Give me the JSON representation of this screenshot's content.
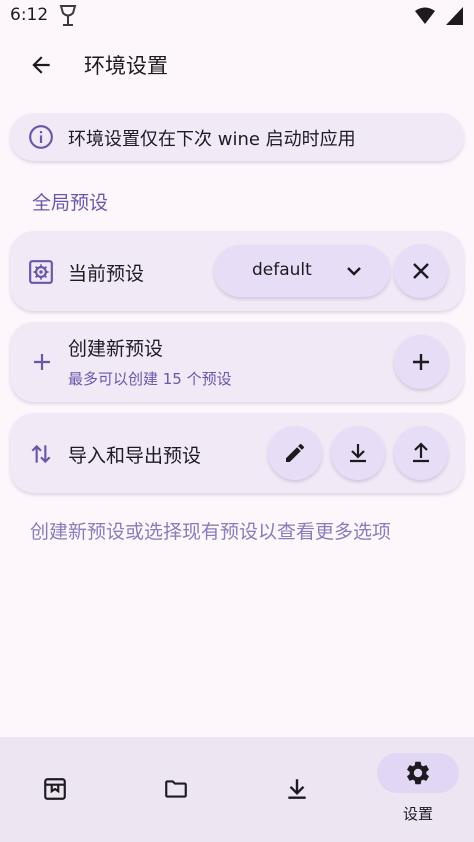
{
  "status_bar": {
    "time": "6:12",
    "icons": [
      "wine-glass-icon",
      "wifi-icon",
      "battery-icon"
    ]
  },
  "app_bar": {
    "back_icon": "arrow-left-icon",
    "title": "环境设置"
  },
  "info_banner": {
    "icon": "info-icon",
    "text": "环境设置仅在下次 wine 启动时应用"
  },
  "section_title": "全局预设",
  "current_preset": {
    "icon": "settings-box-icon",
    "label": "当前预设",
    "selected_value": "default",
    "dropdown_icon": "chevron-down-icon",
    "clear_icon": "close-icon"
  },
  "create_preset": {
    "icon": "plus-icon",
    "title": "创建新预设",
    "subtitle": "最多可以创建 15 个预设",
    "button_icon": "plus-icon"
  },
  "import_export": {
    "icon": "swap-vertical-icon",
    "label": "导入和导出预设",
    "buttons": [
      "pencil-icon",
      "download-icon",
      "upload-icon"
    ]
  },
  "hint": "创建新预设或选择现有预设以查看更多选项",
  "bottom_nav": {
    "items": [
      {
        "icon": "archive-box-icon",
        "label": ""
      },
      {
        "icon": "folder-icon",
        "label": ""
      },
      {
        "icon": "download-icon",
        "label": ""
      },
      {
        "icon": "gear-icon",
        "label": "设置",
        "active": true
      }
    ]
  },
  "colors": {
    "background": "#fdf7fc",
    "card": "#f1e9f6",
    "accent": "#6a57a8",
    "tonal_button": "#e7ddf6",
    "nav_background": "#ede6f2",
    "nav_active_pill": "#e1d6f4"
  }
}
